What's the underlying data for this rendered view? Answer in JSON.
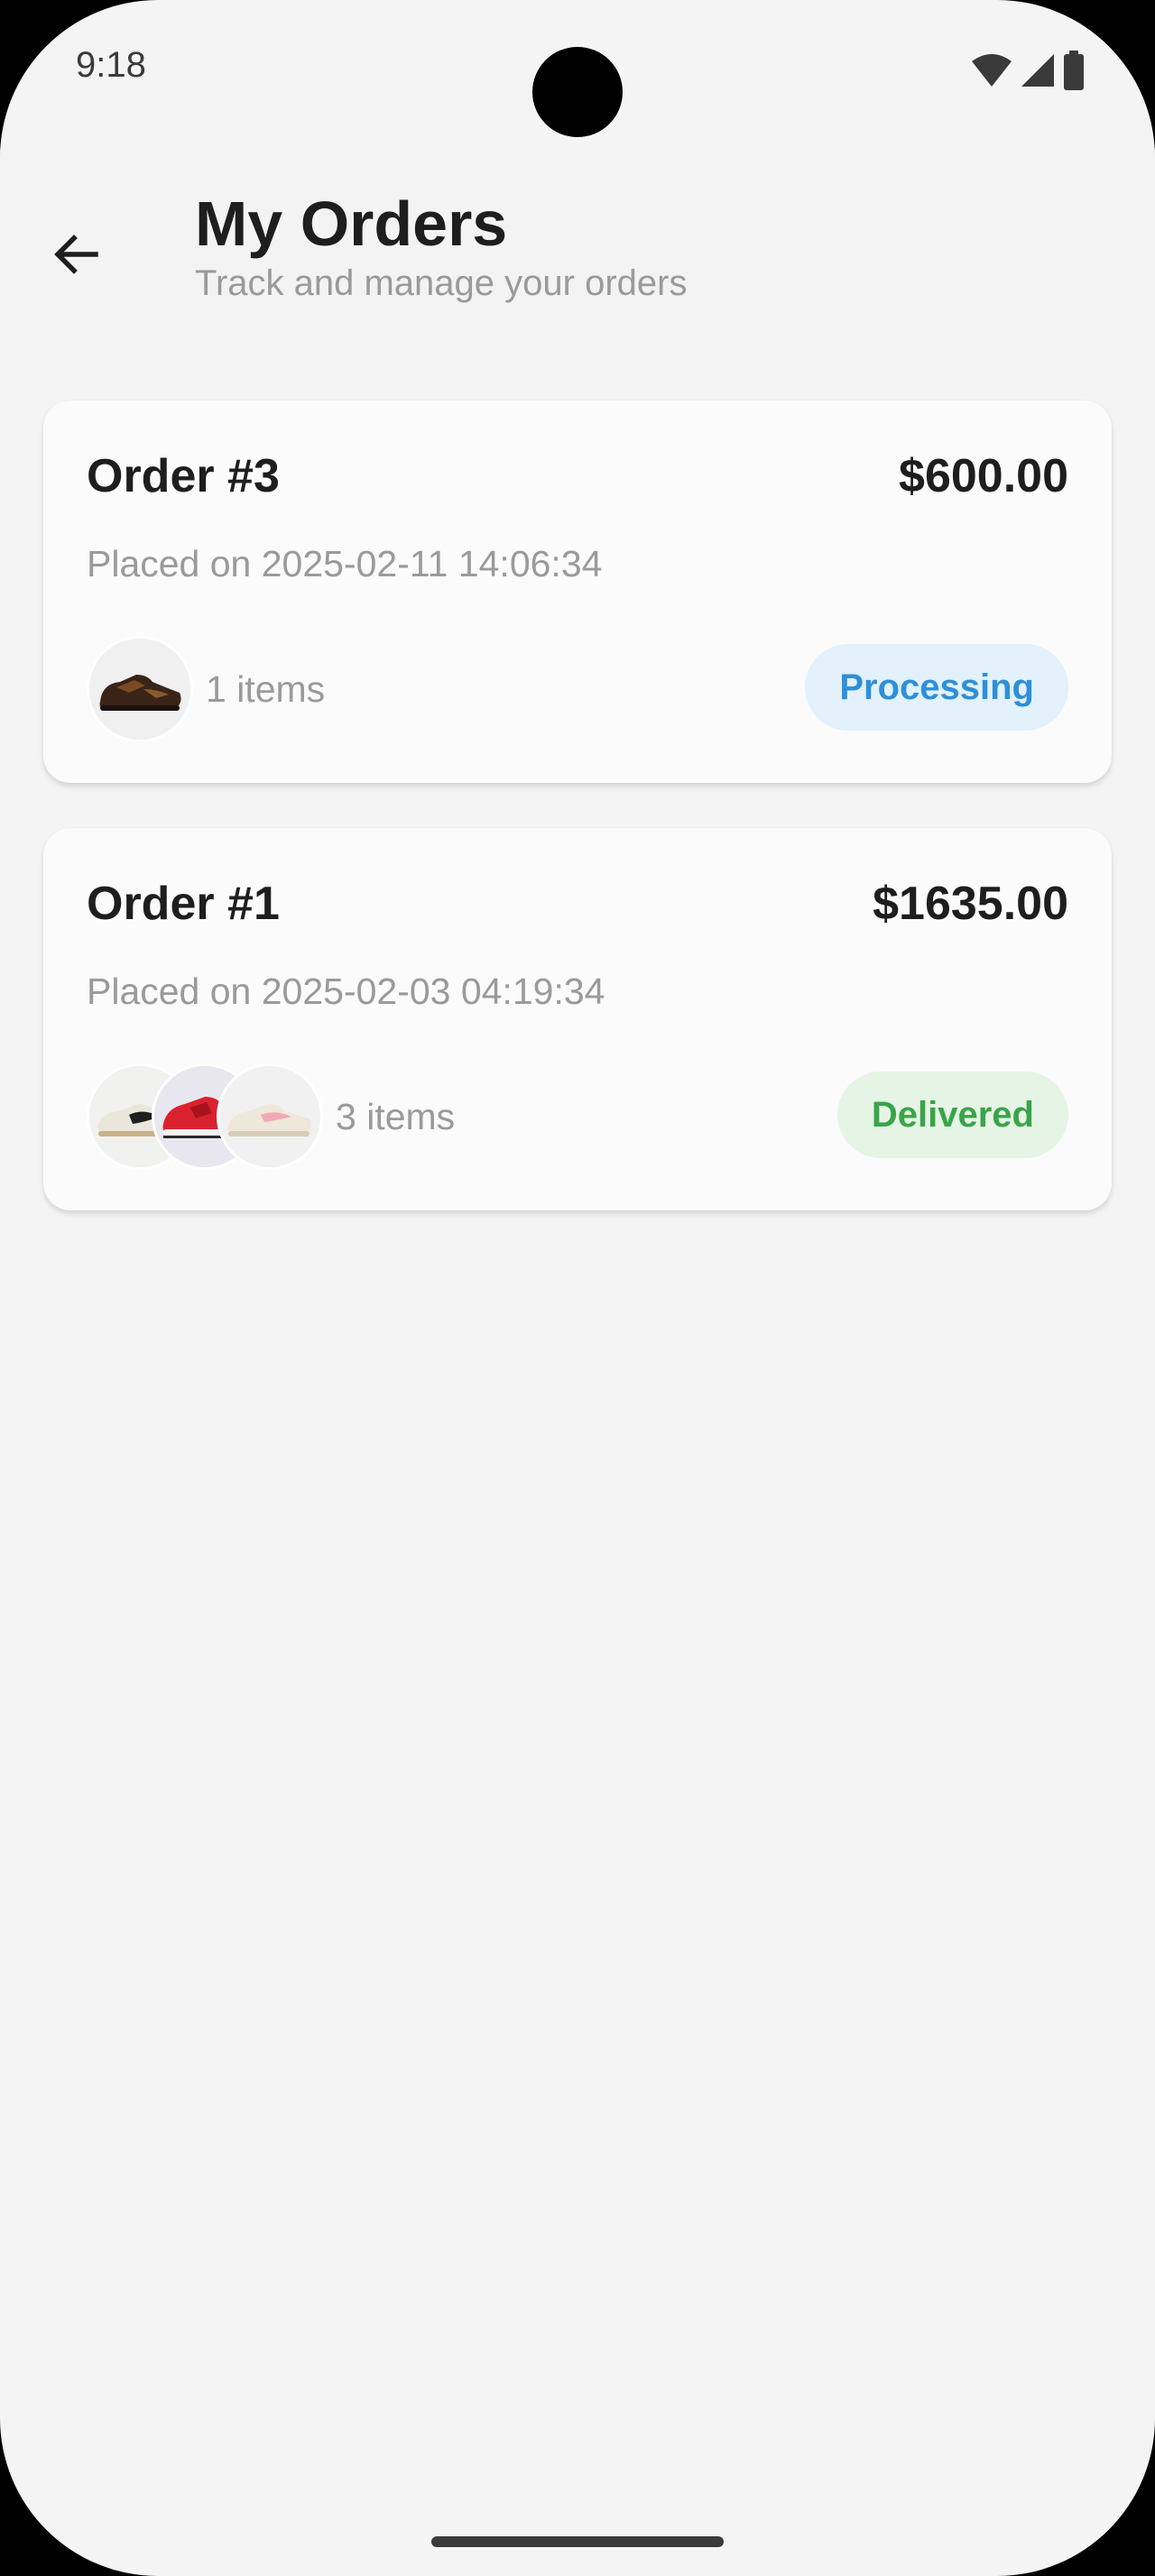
{
  "status_bar": {
    "time": "9:18"
  },
  "header": {
    "title": "My Orders",
    "subtitle": "Track and manage your orders"
  },
  "orders": [
    {
      "title": "Order #3",
      "total": "$600.00",
      "placed": "Placed on 2025-02-11 14:06:34",
      "items_label": "1 items",
      "status": "Processing",
      "status_color": "#2f8fd8",
      "status_bg": "#e2f1fc"
    },
    {
      "title": "Order #1",
      "total": "$1635.00",
      "placed": "Placed on 2025-02-03 04:19:34",
      "items_label": "3 items",
      "status": "Delivered",
      "status_color": "#3aa449",
      "status_bg": "#e6f4e6"
    }
  ],
  "icons": {
    "back": "arrow-left-icon",
    "wifi": "wifi-icon",
    "signal": "signal-icon",
    "battery": "battery-icon"
  }
}
